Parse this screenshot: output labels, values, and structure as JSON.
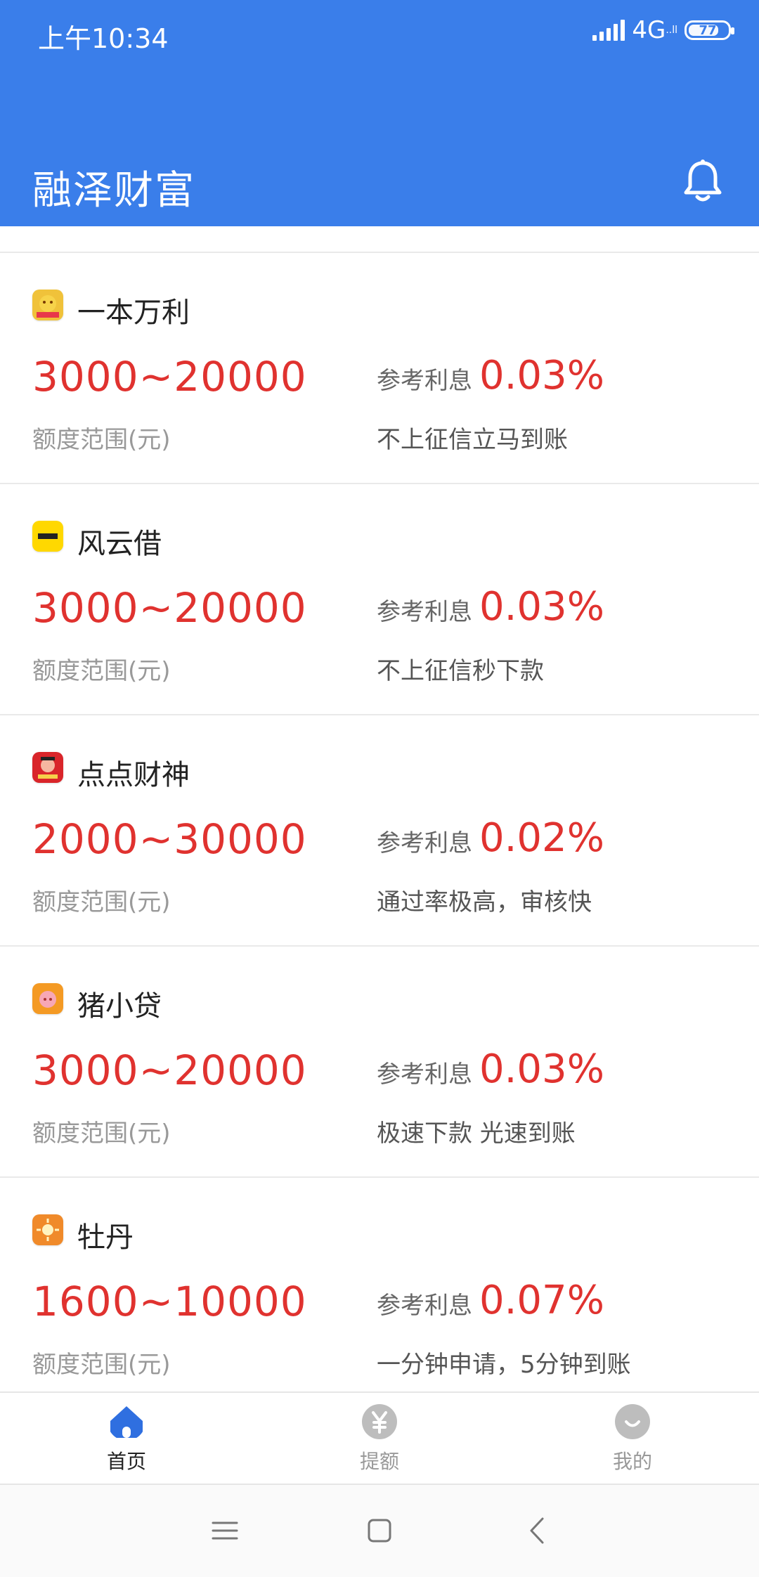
{
  "status_bar": {
    "time": "上午10:34",
    "network": "4G",
    "network_sub": "..ll",
    "battery": "77",
    "battery_level": 0.77
  },
  "header": {
    "title": "融泽财富"
  },
  "labels": {
    "rate_label": "参考利息",
    "range_label": "额度范围(元)"
  },
  "products": [
    {
      "name": "一本万利",
      "range": "3000~20000",
      "rate": "0.03%",
      "tagline": "不上征信立马到账",
      "logo_color": "#f0c23a"
    },
    {
      "name": "风云借",
      "range": "3000~20000",
      "rate": "0.03%",
      "tagline": "不上征信秒下款",
      "logo_color": "#ffd800"
    },
    {
      "name": "点点财神",
      "range": "2000~30000",
      "rate": "0.02%",
      "tagline": "通过率极高，审核快",
      "logo_color": "#d9252a"
    },
    {
      "name": "猪小贷",
      "range": "3000~20000",
      "rate": "0.03%",
      "tagline": "极速下款 光速到账",
      "logo_color": "#f49a24"
    },
    {
      "name": "牡丹",
      "range": "1600~10000",
      "rate": "0.07%",
      "tagline": "一分钟申请，5分钟到账",
      "logo_color": "#f08a2a"
    }
  ],
  "bottom_nav": [
    {
      "label": "首页",
      "icon": "home-icon",
      "active": true
    },
    {
      "label": "提额",
      "icon": "yuan-icon",
      "active": false
    },
    {
      "label": "我的",
      "icon": "profile-icon",
      "active": false
    }
  ],
  "colors": {
    "primary": "#3a7eea",
    "accent_red": "#e0322f"
  }
}
